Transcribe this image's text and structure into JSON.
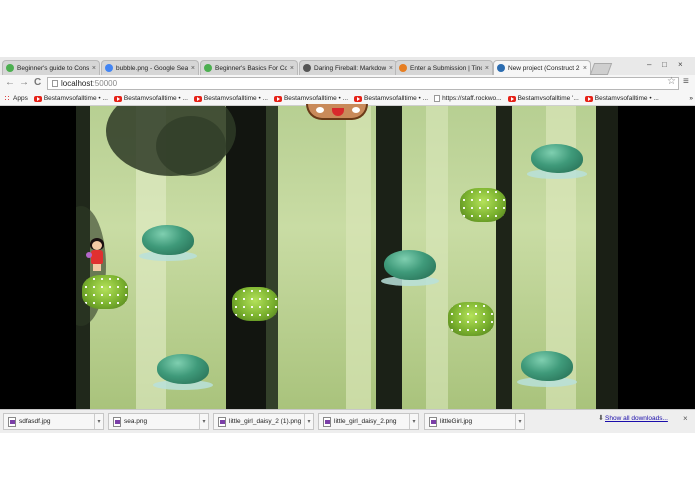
{
  "tabs": [
    {
      "label": "Beginner's guide to Const",
      "active": false,
      "favicon_color": "#4caf50"
    },
    {
      "label": "bubble.png - Google Sear",
      "active": false,
      "favicon_color": "#4285f4"
    },
    {
      "label": "Beginner's Basics For Con",
      "active": false,
      "favicon_color": "#4caf50"
    },
    {
      "label": "Daring Fireball: Markdow",
      "active": false,
      "favicon_color": "#555555"
    },
    {
      "label": "Enter a Submission | Tino",
      "active": false,
      "favicon_color": "#e67e22"
    },
    {
      "label": "New project (Construct 2",
      "active": true,
      "favicon_color": "#2b6cb0"
    }
  ],
  "close_glyph": "×",
  "window_controls": {
    "minimize": "–",
    "maximize": "□",
    "close": "×"
  },
  "toolbar": {
    "back": "←",
    "forward": "→",
    "reload": "C",
    "url_host": "localhost",
    "url_port": ":50000",
    "star": "☆",
    "menu": "≡"
  },
  "bookmarks": [
    {
      "label": "Apps",
      "icon": "apps-grid-icon"
    },
    {
      "label": "Bestamvsofalltime • ...",
      "icon": "youtube-icon"
    },
    {
      "label": "Bestamvsofalltime • ...",
      "icon": "youtube-icon"
    },
    {
      "label": "Bestamvsofalltime • ...",
      "icon": "youtube-icon"
    },
    {
      "label": "Bestamvsofalltime • ...",
      "icon": "youtube-icon"
    },
    {
      "label": "Bestamvsofalltime • ...",
      "icon": "youtube-icon"
    },
    {
      "label": "https://staff.rockwo...",
      "icon": "page-icon"
    },
    {
      "label": "Bestamvsofalltime '...",
      "icon": "youtube-icon"
    },
    {
      "label": "Bestamvsofalltime • ...",
      "icon": "youtube-icon"
    }
  ],
  "bookmarks_more": "»",
  "downloads": [
    {
      "name": "sdfasdf.jpg"
    },
    {
      "name": "sea.png"
    },
    {
      "name": "little_girl_daisy_2 (1).png"
    },
    {
      "name": "little_girl_daisy_2.png"
    },
    {
      "name": "littleGirl.jpg"
    }
  ],
  "downloads_show_all": "Show all downloads...",
  "colors": {
    "bush_green": "#3f9a7a",
    "flower_green": "#7ab12e",
    "girl_dress": "#e03030",
    "tab_active": "#f6f6f6"
  }
}
